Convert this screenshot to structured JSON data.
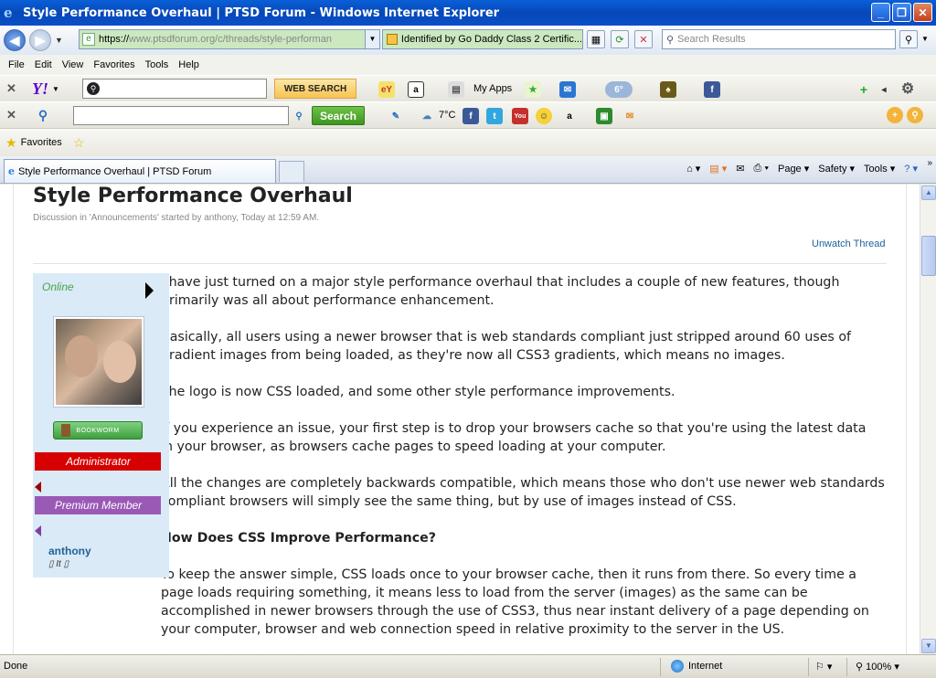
{
  "window": {
    "title": "Style Performance Overhaul | PTSD Forum - Windows Internet Explorer"
  },
  "nav": {
    "url_scheme": "https://",
    "url_host": "www.ptsdforum.org/c/threads/style-performan",
    "certificate": "Identified by Go Daddy Class 2 Certific...",
    "search_placeholder": "Search Results"
  },
  "menu": [
    "File",
    "Edit",
    "View",
    "Favorites",
    "Tools",
    "Help"
  ],
  "toolbar1": {
    "web_search_label": "WEB SEARCH",
    "my_apps_label": "My Apps"
  },
  "toolbar2": {
    "search_button_label": "Search",
    "temperature": "7°C"
  },
  "favorites": {
    "label": "Favorites"
  },
  "tab": {
    "title": "Style Performance Overhaul | PTSD Forum"
  },
  "commands": [
    "Page",
    "Safety",
    "Tools"
  ],
  "thread": {
    "title": "Style Performance Overhaul",
    "meta": "Discussion in 'Announcements' started by anthony, Today at 12:59 AM.",
    "unwatch": "Unwatch Thread"
  },
  "user": {
    "status": "Online",
    "badge_bookworm": "BOOKWORM",
    "role_admin": "Administrator",
    "role_premium": "Premium Member",
    "name": "anthony",
    "title": "▯ It ▯"
  },
  "post": {
    "p1a": "I have just turned on a major style performance overhaul that includes a couple of new features, though",
    "p1b": "primarily was all about performance enhancement.",
    "p2a": "Basically, all users using a newer browser that is web standards compliant just stripped around 60 uses of",
    "p2b": "gradient images from being loaded, as they're now all CSS3 gradients, which means no images.",
    "p3": "The logo is now CSS loaded, and some other style performance improvements.",
    "p4a": "If you experience an issue, your first step is to drop your browsers cache so that you're using the latest data",
    "p4b": "in your browser, as browsers cache pages to speed loading at your computer.",
    "p5a": "All the changes are completely backwards compatible, which means those who don't use newer web standards",
    "p5b": "compliant browsers will simply see the same thing, but by use of images instead of CSS.",
    "heading": "How Does CSS Improve Performance?",
    "p6a": "To keep the answer simple, CSS loads once to your browser cache, then it runs from there. So every time a",
    "p6b": "page loads requiring something, it means less to load from the server (images) as the same can be",
    "p6c": "accomplished in newer browsers through the use of CSS3, thus near instant delivery of a page depending on",
    "p6d": "your computer, browser and web connection speed in relative proximity to the server in the US."
  },
  "status": {
    "text": "Done",
    "zone": "Internet",
    "zoom": "100%"
  }
}
